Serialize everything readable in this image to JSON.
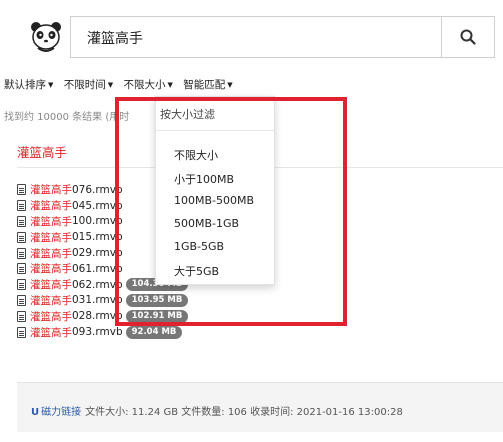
{
  "search": {
    "query": "灌篮高手"
  },
  "filters": [
    {
      "label": "默认排序"
    },
    {
      "label": "不限时间"
    },
    {
      "label": "不限大小"
    },
    {
      "label": "智能匹配"
    }
  ],
  "results_summary": "找到约 10000 条结果 (用时",
  "result": {
    "title": "灌篮高手",
    "files": [
      {
        "highlight": "灌篮高手",
        "rest": "076.rmvb",
        "size": ""
      },
      {
        "highlight": "灌篮高手",
        "rest": "045.rmvb",
        "size": ""
      },
      {
        "highlight": "灌篮高手",
        "rest": "100.rmvb",
        "size": ""
      },
      {
        "highlight": "灌篮高手",
        "rest": "015.rmvb",
        "size": ""
      },
      {
        "highlight": "灌篮高手",
        "rest": "029.rmvb",
        "size": ""
      },
      {
        "highlight": "灌篮高手",
        "rest": "061.rmvb",
        "size": ""
      },
      {
        "highlight": "灌篮高手",
        "rest": "062.rmvb",
        "size": "104.38 MB"
      },
      {
        "highlight": "灌篮高手",
        "rest": "031.rmvb",
        "size": "103.95 MB"
      },
      {
        "highlight": "灌篮高手",
        "rest": "028.rmvb",
        "size": "102.91 MB"
      },
      {
        "highlight": "灌篮高手",
        "rest": "093.rmvb",
        "size": "92.04 MB"
      }
    ],
    "footer": {
      "magnet_label": "磁力链接",
      "info": "文件大小: 11.24 GB 文件数量: 106 收录时间: 2021-01-16 13:00:28"
    }
  },
  "size_dropdown": {
    "header": "按大小过滤",
    "options": [
      "不限大小",
      "小于100MB",
      "100MB-500MB",
      "500MB-1GB",
      "1GB-5GB",
      "大于5GB"
    ]
  },
  "colors": {
    "highlight_box": "#e0212f",
    "keyword": "#dd2222",
    "link": "#2b5aa8",
    "badge": "#777777"
  }
}
